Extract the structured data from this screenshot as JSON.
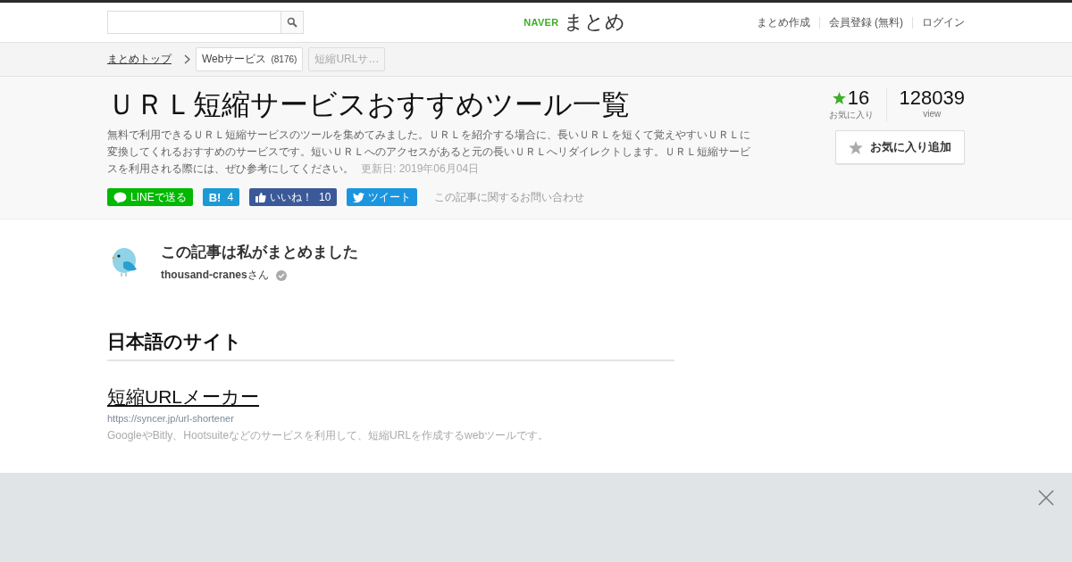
{
  "header": {
    "logo": {
      "brand": "NAVER",
      "name": "まとめ"
    },
    "nav": [
      "まとめ作成",
      "会員登録 (無料)",
      "ログイン"
    ]
  },
  "breadcrumb": {
    "top": "まとめトップ",
    "items": [
      {
        "label": "Webサービス",
        "count": "(8176)",
        "disabled": false
      },
      {
        "label": "短縮URLサ…",
        "disabled": true
      }
    ]
  },
  "article": {
    "title": "ＵＲＬ短縮サービスおすすめツール一覧",
    "description": "無料で利用できるＵＲＬ短縮サービスのツールを集めてみました。ＵＲＬを紹介する場合に、長いＵＲＬを短くて覚えやすいＵＲＬに変換してくれるおすすめのサービスです。短いＵＲＬへのアクセスがあると元の長いＵＲＬへリダイレクトします。ＵＲＬ短縮サービスを利用される際には、ぜひ参考にしてください。",
    "updated": "更新日: 2019年06月04日",
    "favorites": {
      "count": "16",
      "label": "お気に入り"
    },
    "views": {
      "count": "128039",
      "label": "view"
    },
    "favorite_button": "お気に入り追加",
    "share": [
      {
        "kind": "line",
        "label": "LINEで送る"
      },
      {
        "kind": "hatena",
        "label": "B!",
        "count": "4"
      },
      {
        "kind": "facebook",
        "label": "いいね！",
        "count": "10"
      },
      {
        "kind": "twitter",
        "label": "ツイート"
      }
    ],
    "contact": "この記事に関するお問い合わせ"
  },
  "author": {
    "heading": "この記事は私がまとめました",
    "name": "**thousand-cranes**さん"
  },
  "section": {
    "heading": "日本語のサイト",
    "link": {
      "title": "短縮URLメーカー",
      "url": "https://syncer.jp/url-shortener",
      "description": "GoogleやBitly、Hootsuiteなどのサービスを利用して、短縮URLを作成するwebツールです。"
    }
  }
}
